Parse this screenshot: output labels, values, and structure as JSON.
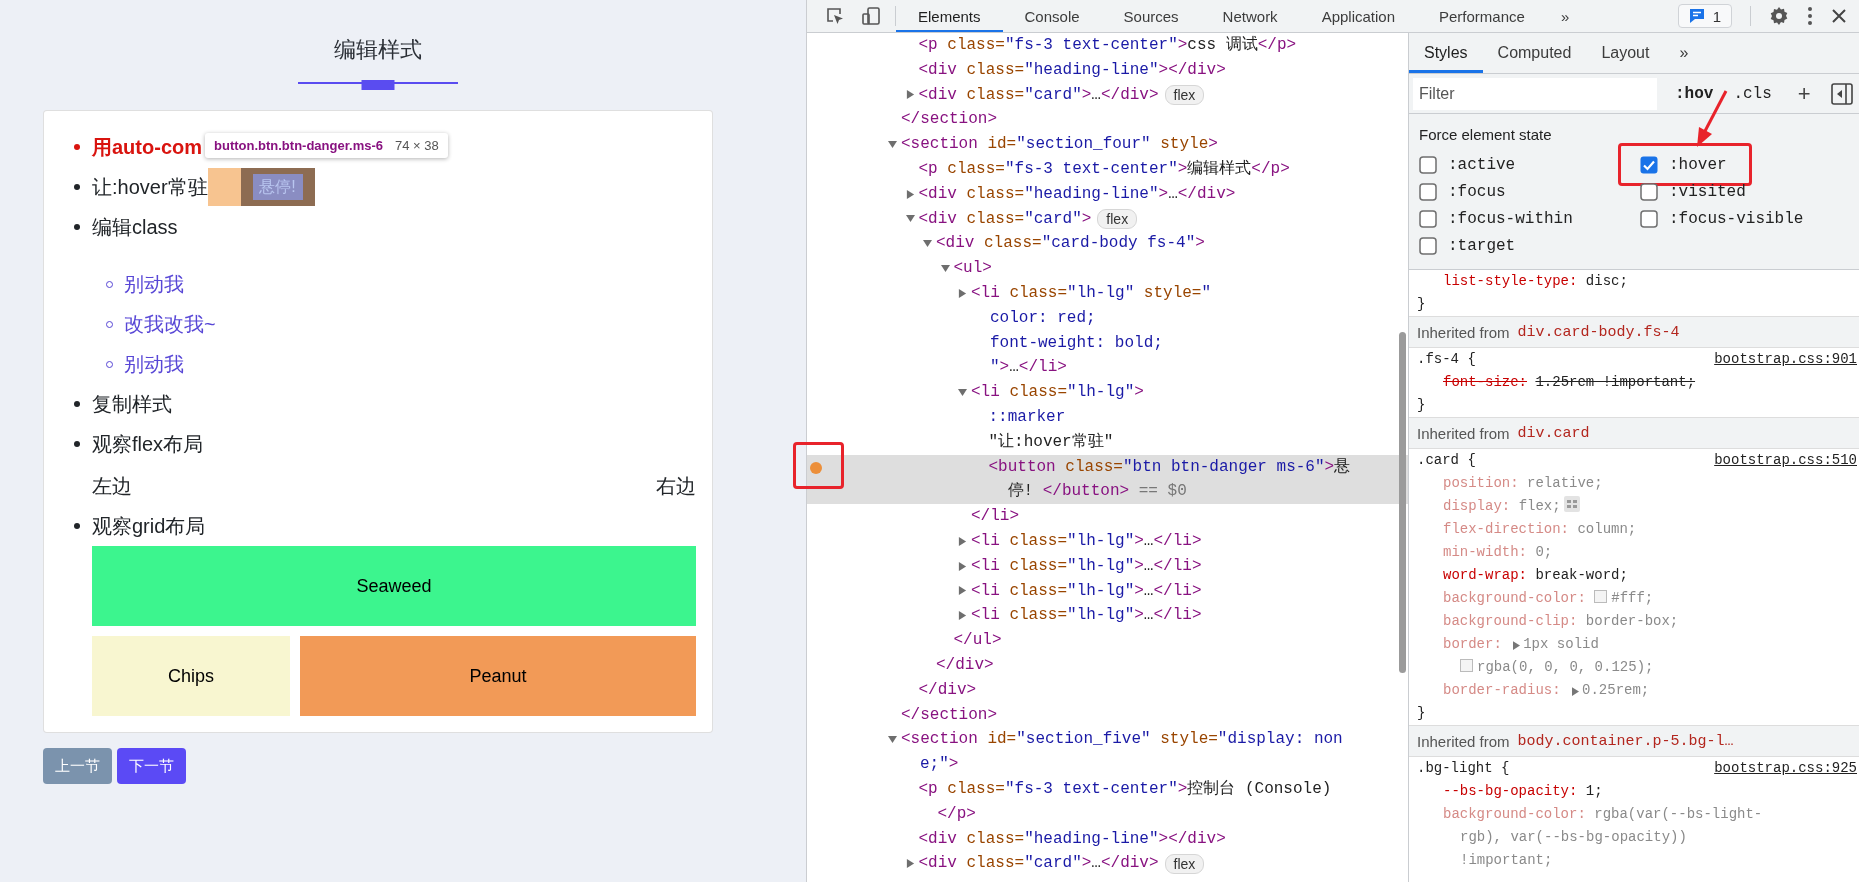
{
  "page": {
    "title": "编辑样式",
    "inspect_tooltip": {
      "selector": "button.btn.btn-danger.ms-6",
      "size": "74 × 38"
    },
    "items": [
      {
        "kind": "emphasis",
        "text": "用auto-com"
      },
      {
        "kind": "hover_button",
        "text": "让:hover常驻",
        "button": {
          "label": "悬停!",
          "inspected": true
        }
      },
      {
        "kind": "sublist",
        "text": "编辑class",
        "children": [
          {
            "text": "别动我"
          },
          {
            "text": "改我改我~"
          },
          {
            "text": "别动我"
          }
        ]
      },
      {
        "kind": "plain",
        "text": "复制样式"
      },
      {
        "kind": "flex",
        "text": "观察flex布局",
        "left": "左边",
        "right": "右边"
      },
      {
        "kind": "grid",
        "text": "观察grid布局",
        "cells": [
          {
            "text": "Seaweed",
            "color": "#3cf58e",
            "wide": true
          },
          {
            "text": "Chips",
            "color": "#f8f6d0",
            "wide": false
          },
          {
            "text": "Peanut",
            "color": "#f29a57",
            "wide": false
          }
        ]
      }
    ],
    "nav_buttons": [
      {
        "label": "上一节",
        "kind": "secondary"
      },
      {
        "label": "下一节",
        "kind": "primary"
      }
    ]
  },
  "devtools": {
    "toolbar": {
      "tabs": [
        {
          "label": "Elements",
          "selected": true
        },
        {
          "label": "Console",
          "selected": false
        },
        {
          "label": "Sources",
          "selected": false
        },
        {
          "label": "Network",
          "selected": false
        },
        {
          "label": "Application",
          "selected": false
        },
        {
          "label": "Performance",
          "selected": false
        }
      ],
      "more": "»",
      "issues": "1"
    },
    "dom_tree": [
      {
        "kind": "parent",
        "expanded": true,
        "selected": false,
        "forced_state": false,
        "children": [
          {
            "kind": "leaf",
            "selected": false,
            "forced_state": false,
            "lines": [
              [
                {
                  "kind": "tag",
                  "text": "<p"
                },
                {
                  "kind": "attr",
                  "text": " class="
                },
                {
                  "kind": "value",
                  "text": "\"fs-3 text-center\""
                },
                {
                  "kind": "tag",
                  "text": ">"
                },
                {
                  "kind": "text",
                  "text": "css 调试"
                },
                {
                  "kind": "tag",
                  "text": "</p>"
                }
              ]
            ]
          },
          {
            "kind": "leaf",
            "selected": false,
            "forced_state": false,
            "lines": [
              [
                {
                  "kind": "tag",
                  "text": "<div"
                },
                {
                  "kind": "attr",
                  "text": " class="
                },
                {
                  "kind": "value",
                  "text": "\"heading-line\""
                },
                {
                  "kind": "tag",
                  "text": "></div>"
                }
              ]
            ]
          },
          {
            "kind": "parent",
            "expanded": false,
            "selected": false,
            "forced_state": false,
            "badge": "flex",
            "lines": [
              [
                {
                  "kind": "tag",
                  "text": "<div"
                },
                {
                  "kind": "attr",
                  "text": " class="
                },
                {
                  "kind": "value",
                  "text": "\"card\""
                },
                {
                  "kind": "tag",
                  "text": ">"
                },
                {
                  "kind": "text",
                  "text": "…"
                },
                {
                  "kind": "tag",
                  "text": "</div>"
                }
              ]
            ]
          }
        ],
        "close": [
          {
            "kind": "tag",
            "text": "</section>"
          }
        ]
      },
      {
        "kind": "parent",
        "expanded": true,
        "selected": false,
        "forced_state": false,
        "lines": [
          [
            {
              "kind": "tag",
              "text": "<section"
            },
            {
              "kind": "attr",
              "text": " id="
            },
            {
              "kind": "value",
              "text": "\"section_four\""
            },
            {
              "kind": "attr",
              "text": " style"
            },
            {
              "kind": "tag",
              "text": ">"
            }
          ]
        ],
        "children": [
          {
            "kind": "leaf",
            "selected": false,
            "forced_state": false,
            "lines": [
              [
                {
                  "kind": "tag",
                  "text": "<p"
                },
                {
                  "kind": "attr",
                  "text": " class="
                },
                {
                  "kind": "value",
                  "text": "\"fs-3 text-center\""
                },
                {
                  "kind": "tag",
                  "text": ">"
                },
                {
                  "kind": "text",
                  "text": "编辑样式"
                },
                {
                  "kind": "tag",
                  "text": "</p>"
                }
              ]
            ]
          },
          {
            "kind": "parent",
            "expanded": false,
            "selected": false,
            "forced_state": false,
            "lines": [
              [
                {
                  "kind": "tag",
                  "text": "<div"
                },
                {
                  "kind": "attr",
                  "text": " class="
                },
                {
                  "kind": "value",
                  "text": "\"heading-line\""
                },
                {
                  "kind": "tag",
                  "text": ">"
                },
                {
                  "kind": "text",
                  "text": "…"
                },
                {
                  "kind": "tag",
                  "text": "</div>"
                }
              ]
            ]
          },
          {
            "kind": "parent",
            "expanded": true,
            "selected": false,
            "forced_state": false,
            "badge": "flex",
            "lines": [
              [
                {
                  "kind": "tag",
                  "text": "<div"
                },
                {
                  "kind": "attr",
                  "text": " class="
                },
                {
                  "kind": "value",
                  "text": "\"card\""
                },
                {
                  "kind": "tag",
                  "text": ">"
                }
              ]
            ],
            "children": [
              {
                "kind": "parent",
                "expanded": true,
                "selected": false,
                "forced_state": false,
                "lines": [
                  [
                    {
                      "kind": "tag",
                      "text": "<div"
                    },
                    {
                      "kind": "attr",
                      "text": " class="
                    },
                    {
                      "kind": "value",
                      "text": "\"card-body fs-4\""
                    },
                    {
                      "kind": "tag",
                      "text": ">"
                    }
                  ]
                ],
                "children": [
                  {
                    "kind": "parent",
                    "expanded": true,
                    "selected": false,
                    "forced_state": false,
                    "lines": [
                      [
                        {
                          "kind": "tag",
                          "text": "<ul>"
                        }
                      ]
                    ],
                    "children": [
                      {
                        "kind": "parent",
                        "expanded": false,
                        "selected": false,
                        "forced_state": false,
                        "lines": [
                          [
                            {
                              "kind": "tag",
                              "text": "<li"
                            },
                            {
                              "kind": "attr",
                              "text": " class="
                            },
                            {
                              "kind": "value",
                              "text": "\"lh-lg\""
                            },
                            {
                              "kind": "attr",
                              "text": " style="
                            },
                            {
                              "kind": "value",
                              "text": "\""
                            }
                          ],
                          [
                            {
                              "kind": "value",
                              "text": "color: red;"
                            }
                          ],
                          [
                            {
                              "kind": "value",
                              "text": "font-weight: bold;"
                            }
                          ],
                          [
                            {
                              "kind": "value",
                              "text": "\""
                            },
                            {
                              "kind": "tag",
                              "text": ">"
                            },
                            {
                              "kind": "text",
                              "text": "…"
                            },
                            {
                              "kind": "tag",
                              "text": "</li>"
                            }
                          ]
                        ]
                      },
                      {
                        "kind": "parent",
                        "expanded": true,
                        "selected": false,
                        "forced_state": false,
                        "lines": [
                          [
                            {
                              "kind": "tag",
                              "text": "<li"
                            },
                            {
                              "kind": "attr",
                              "text": " class="
                            },
                            {
                              "kind": "value",
                              "text": "\"lh-lg\""
                            },
                            {
                              "kind": "tag",
                              "text": ">"
                            }
                          ]
                        ],
                        "children": [
                          {
                            "kind": "leaf",
                            "selected": false,
                            "forced_state": false,
                            "lines": [
                              [
                                {
                                  "kind": "pseudo",
                                  "text": "::marker"
                                }
                              ]
                            ]
                          },
                          {
                            "kind": "leaf",
                            "selected": false,
                            "forced_state": false,
                            "lines": [
                              [
                                {
                                  "kind": "text",
                                  "text": "\"让:hover常驻\""
                                }
                              ]
                            ]
                          },
                          {
                            "kind": "leaf",
                            "selected": true,
                            "forced_state": true,
                            "lines": [
                              [
                                {
                                  "kind": "tag",
                                  "text": "<button"
                                },
                                {
                                  "kind": "attr",
                                  "text": " class="
                                },
                                {
                                  "kind": "value",
                                  "text": "\"btn btn-danger ms-6\""
                                },
                                {
                                  "kind": "tag",
                                  "text": ">"
                                },
                                {
                                  "kind": "text",
                                  "text": "悬"
                                }
                              ],
                              [
                                {
                                  "kind": "text",
                                  "text": "停! "
                                },
                                {
                                  "kind": "tag",
                                  "text": "</button>"
                                },
                                {
                                  "kind": "ref",
                                  "text": " == $0"
                                }
                              ]
                            ]
                          }
                        ],
                        "close": [
                          {
                            "kind": "tag",
                            "text": "</li>"
                          }
                        ]
                      },
                      {
                        "kind": "parent",
                        "expanded": false,
                        "selected": false,
                        "forced_state": false,
                        "lines": [
                          [
                            {
                              "kind": "tag",
                              "text": "<li"
                            },
                            {
                              "kind": "attr",
                              "text": " class="
                            },
                            {
                              "kind": "value",
                              "text": "\"lh-lg\""
                            },
                            {
                              "kind": "tag",
                              "text": ">"
                            },
                            {
                              "kind": "text",
                              "text": "…"
                            },
                            {
                              "kind": "tag",
                              "text": "</li>"
                            }
                          ]
                        ]
                      },
                      {
                        "kind": "parent",
                        "expanded": false,
                        "selected": false,
                        "forced_state": false,
                        "lines": [
                          [
                            {
                              "kind": "tag",
                              "text": "<li"
                            },
                            {
                              "kind": "attr",
                              "text": " class="
                            },
                            {
                              "kind": "value",
                              "text": "\"lh-lg\""
                            },
                            {
                              "kind": "tag",
                              "text": ">"
                            },
                            {
                              "kind": "text",
                              "text": "…"
                            },
                            {
                              "kind": "tag",
                              "text": "</li>"
                            }
                          ]
                        ]
                      },
                      {
                        "kind": "parent",
                        "expanded": false,
                        "selected": false,
                        "forced_state": false,
                        "lines": [
                          [
                            {
                              "kind": "tag",
                              "text": "<li"
                            },
                            {
                              "kind": "attr",
                              "text": " class="
                            },
                            {
                              "kind": "value",
                              "text": "\"lh-lg\""
                            },
                            {
                              "kind": "tag",
                              "text": ">"
                            },
                            {
                              "kind": "text",
                              "text": "…"
                            },
                            {
                              "kind": "tag",
                              "text": "</li>"
                            }
                          ]
                        ]
                      },
                      {
                        "kind": "parent",
                        "expanded": false,
                        "selected": false,
                        "forced_state": false,
                        "lines": [
                          [
                            {
                              "kind": "tag",
                              "text": "<li"
                            },
                            {
                              "kind": "attr",
                              "text": " class="
                            },
                            {
                              "kind": "value",
                              "text": "\"lh-lg\""
                            },
                            {
                              "kind": "tag",
                              "text": ">"
                            },
                            {
                              "kind": "text",
                              "text": "…"
                            },
                            {
                              "kind": "tag",
                              "text": "</li>"
                            }
                          ]
                        ]
                      }
                    ],
                    "close": [
                      {
                        "kind": "tag",
                        "text": "</ul>"
                      }
                    ]
                  }
                ],
                "close": [
                  {
                    "kind": "tag",
                    "text": "</div>"
                  }
                ]
              }
            ],
            "close": [
              {
                "kind": "tag",
                "text": "</div>"
              }
            ]
          }
        ],
        "close": [
          {
            "kind": "tag",
            "text": "</section>"
          }
        ]
      },
      {
        "kind": "parent",
        "expanded": true,
        "selected": false,
        "forced_state": false,
        "lines": [
          [
            {
              "kind": "tag",
              "text": "<section"
            },
            {
              "kind": "attr",
              "text": " id="
            },
            {
              "kind": "value",
              "text": "\"section_five\""
            },
            {
              "kind": "attr",
              "text": " style="
            },
            {
              "kind": "value",
              "text": "\"display: non"
            }
          ],
          [
            {
              "kind": "value",
              "text": "e;\""
            },
            {
              "kind": "tag",
              "text": ">"
            }
          ]
        ],
        "children": [
          {
            "kind": "leaf",
            "selected": false,
            "forced_state": false,
            "lines": [
              [
                {
                  "kind": "tag",
                  "text": "<p"
                },
                {
                  "kind": "attr",
                  "text": " class="
                },
                {
                  "kind": "value",
                  "text": "\"fs-3 text-center\""
                },
                {
                  "kind": "tag",
                  "text": ">"
                },
                {
                  "kind": "text",
                  "text": "控制台 (Console)"
                }
              ],
              [
                {
                  "kind": "tag",
                  "text": "</p>"
                }
              ]
            ]
          },
          {
            "kind": "leaf",
            "selected": false,
            "forced_state": false,
            "lines": [
              [
                {
                  "kind": "tag",
                  "text": "<div"
                },
                {
                  "kind": "attr",
                  "text": " class="
                },
                {
                  "kind": "value",
                  "text": "\"heading-line\""
                },
                {
                  "kind": "tag",
                  "text": "></div>"
                }
              ]
            ]
          },
          {
            "kind": "parent",
            "expanded": false,
            "selected": false,
            "forced_state": false,
            "badge": "flex",
            "lines": [
              [
                {
                  "kind": "tag",
                  "text": "<div"
                },
                {
                  "kind": "attr",
                  "text": " class="
                },
                {
                  "kind": "value",
                  "text": "\"card\""
                },
                {
                  "kind": "tag",
                  "text": ">"
                },
                {
                  "kind": "text",
                  "text": "…"
                },
                {
                  "kind": "tag",
                  "text": "</div>"
                }
              ]
            ]
          }
        ]
      }
    ],
    "styles": {
      "tabs": [
        {
          "label": "Styles",
          "selected": true
        },
        {
          "label": "Computed",
          "selected": false
        },
        {
          "label": "Layout",
          "selected": false
        }
      ],
      "more": "»",
      "filter": {
        "placeholder": "Filter"
      },
      "hov": ":hov",
      "cls": ".cls",
      "add": "+",
      "force_state": {
        "title": "Force element state",
        "states": [
          {
            "label": ":active",
            "checked": false,
            "annotated": false
          },
          {
            "label": ":hover",
            "checked": true,
            "annotated": true
          },
          {
            "label": ":focus",
            "checked": false,
            "annotated": false
          },
          {
            "label": ":visited",
            "checked": false,
            "annotated": false
          },
          {
            "label": ":focus-within",
            "checked": false,
            "annotated": false
          },
          {
            "label": ":focus-visible",
            "checked": false,
            "annotated": false
          },
          {
            "label": ":target",
            "checked": false,
            "annotated": false
          }
        ]
      },
      "sections": [
        {
          "properties": [
            {
              "kind": "plain",
              "name": "list-style-type:",
              "value": "disc;",
              "faded": false,
              "overridden": false
            }
          ],
          "close": "}"
        },
        {
          "inherited_label": "Inherited from",
          "inherited_from": "div.card-body.fs-4",
          "selector": ".fs-4 {",
          "source": "bootstrap.css:901",
          "properties": [
            {
              "kind": "plain",
              "name": "font-size:",
              "value": "1.25rem !important;",
              "faded": false,
              "overridden": true
            }
          ],
          "close": "}"
        },
        {
          "inherited_label": "Inherited from",
          "inherited_from": "div.card",
          "selector": ".card {",
          "source": "bootstrap.css:510",
          "properties": [
            {
              "kind": "plain",
              "name": "position:",
              "value": "relative;",
              "faded": true,
              "overridden": false
            },
            {
              "kind": "flex",
              "name": "display:",
              "value": "flex;",
              "faded": true,
              "overridden": false
            },
            {
              "kind": "plain",
              "name": "flex-direction:",
              "value": "column;",
              "faded": true,
              "overridden": false
            },
            {
              "kind": "plain",
              "name": "min-width:",
              "value": "0;",
              "faded": true,
              "overridden": false
            },
            {
              "kind": "plain",
              "name": "word-wrap:",
              "value": "break-word;",
              "faded": false,
              "overridden": false
            },
            {
              "kind": "plain",
              "name": "background-color:",
              "value": "#fff;",
              "swatch": true,
              "faded": true,
              "overridden": false
            },
            {
              "kind": "plain",
              "name": "background-clip:",
              "value": "border-box;",
              "faded": true,
              "overridden": false
            },
            {
              "kind": "shorthand",
              "name": "border:",
              "value": "1px solid",
              "continuation": [
                "rgba(0, 0, 0, 0.125);"
              ],
              "swatch": true,
              "faded": true,
              "overridden": false
            },
            {
              "kind": "shorthand",
              "name": "border-radius:",
              "value": "0.25rem;",
              "faded": true,
              "overridden": false
            }
          ],
          "close": "}"
        },
        {
          "inherited_label": "Inherited from",
          "inherited_from": "body.container.p-5.bg-l…",
          "selector": ".bg-light {",
          "source": "bootstrap.css:925",
          "properties": [
            {
              "kind": "plain",
              "name": "--bs-bg-opacity:",
              "value": "1;",
              "faded": false,
              "overridden": false
            },
            {
              "kind": "plain",
              "name": "background-color:",
              "value": "rgba(var(--bs-light-",
              "continuation": [
                "rgb), var(--bs-bg-opacity))",
                "!important;"
              ],
              "faded": true,
              "overridden": false
            }
          ]
        }
      ]
    }
  }
}
